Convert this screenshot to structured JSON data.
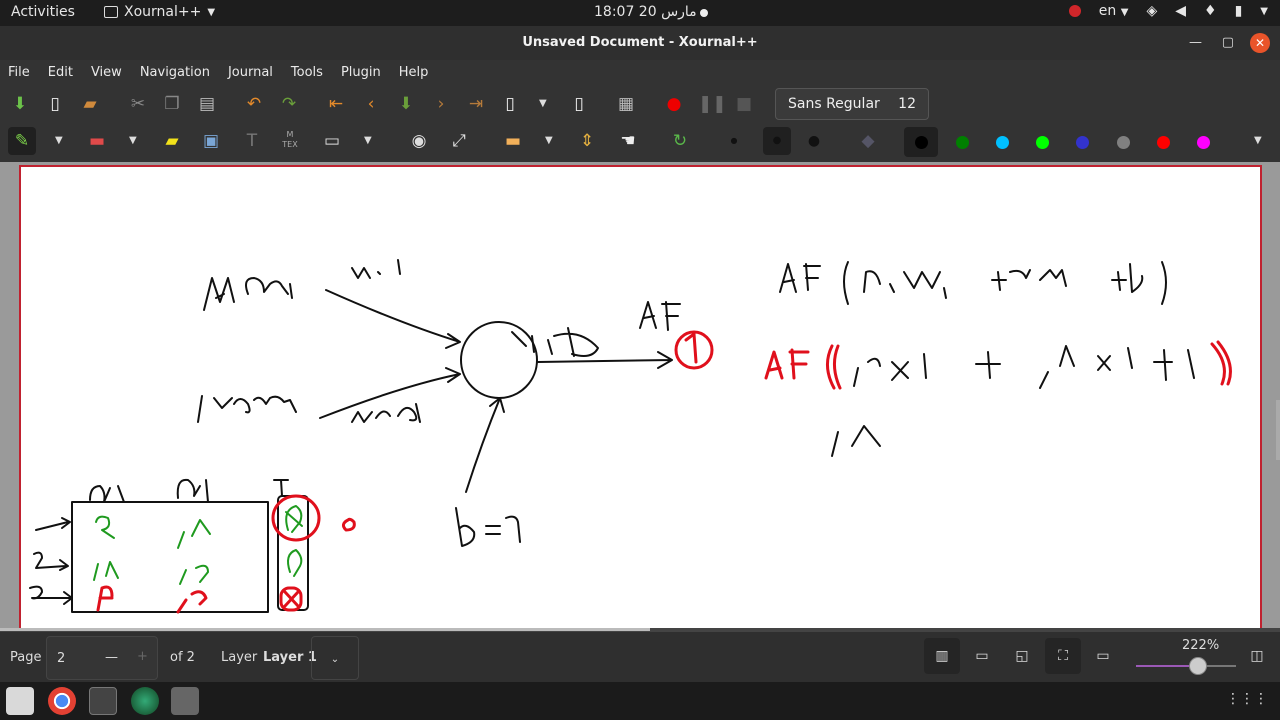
{
  "topbar": {
    "activities": "Activities",
    "app_name": "Xournal++",
    "clock": "18:07  20 مارس",
    "lang": "en"
  },
  "window": {
    "title": "Unsaved Document - Xournal++"
  },
  "menu": {
    "items": [
      "File",
      "Edit",
      "View",
      "Navigation",
      "Journal",
      "Tools",
      "Plugin",
      "Help"
    ]
  },
  "toolbar": {
    "font_name": "Sans Regular",
    "font_size": "12",
    "colors": [
      "#000000",
      "#008000",
      "#00c0ff",
      "#00ff00",
      "#3333cc",
      "#808080",
      "#ff0000",
      "#ff00ff"
    ]
  },
  "statusbar": {
    "page_label": "Page",
    "page_value": "2",
    "page_total": "of 2",
    "layer_label": "Layer",
    "layer_value": "Layer 1",
    "zoom": "222%",
    "zoom_fraction": 0.62
  },
  "ink": {
    "black": "#111111",
    "red": "#e0101c",
    "green": "#1f9a1f"
  }
}
